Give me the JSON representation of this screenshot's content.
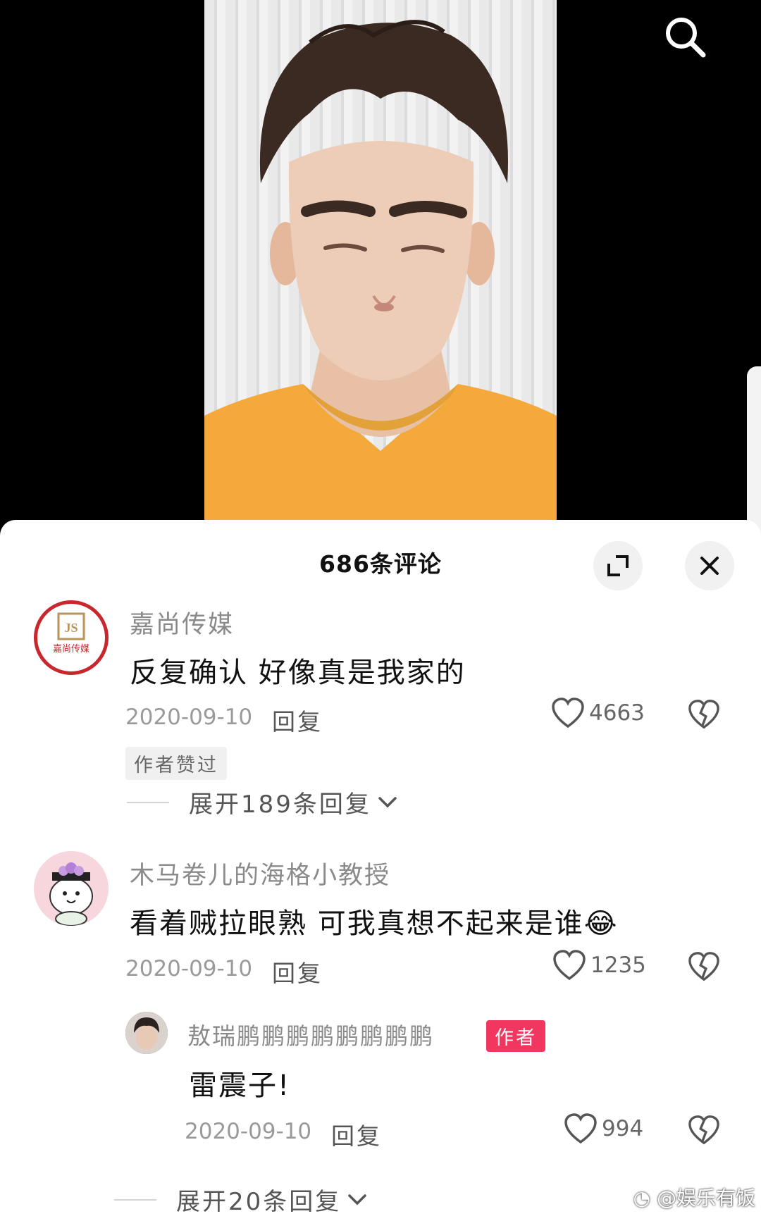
{
  "header": {
    "comment_count_title": "686条评论",
    "search_icon": "search-icon",
    "expand_icon": "expand-icon",
    "close_icon": "close-icon"
  },
  "comments": [
    {
      "username": "嘉尚传媒",
      "avatar_text": "嘉尚传媒",
      "text": "反复确认 好像真是我家的",
      "date": "2020-09-10",
      "reply_label": "回复",
      "likes": "4663",
      "author_liked_badge": "作者赞过",
      "expand_label": "展开189条回复"
    },
    {
      "username": "木马卷儿的海格小教授",
      "text": "看着贼拉眼熟 可我真想不起来是谁",
      "emoji": "😂",
      "date": "2020-09-10",
      "reply_label": "回复",
      "likes": "1235"
    }
  ],
  "reply": {
    "username": "敖瑞鹏鹏鹏鹏鹏鹏鹏鹏",
    "author_badge": "作者",
    "text": "雷震子!",
    "date": "2020-09-10",
    "reply_label": "回复",
    "likes": "994",
    "expand_label": "展开20条回复"
  },
  "watermark": "@娱乐有饭",
  "colors": {
    "author_badge": "#f1365f",
    "avatar_ring": "#c8282d",
    "shirt": "#f4a93a"
  }
}
